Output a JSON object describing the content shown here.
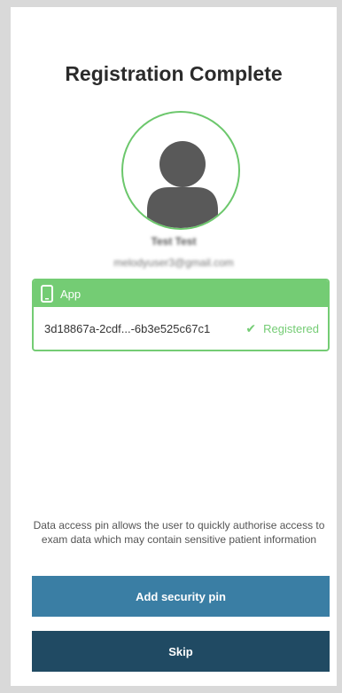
{
  "page": {
    "title": "Registration Complete"
  },
  "user": {
    "name": "Test Test",
    "email": "melodyuser3@gmail.com"
  },
  "device_card": {
    "header_icon": "phone-icon",
    "header_label": "App",
    "device_id": "3d18867a-2cdf...-6b3e525c67c1",
    "status_icon": "check-icon",
    "status": "Registered"
  },
  "info": {
    "text": "Data access pin allows the user to quickly authorise access to exam data which may contain sensitive patient information"
  },
  "buttons": {
    "add_pin": "Add security pin",
    "skip": "Skip"
  },
  "colors": {
    "accent_green": "#74cc74",
    "primary_button": "#3a7ea4",
    "secondary_button": "#204a63"
  }
}
